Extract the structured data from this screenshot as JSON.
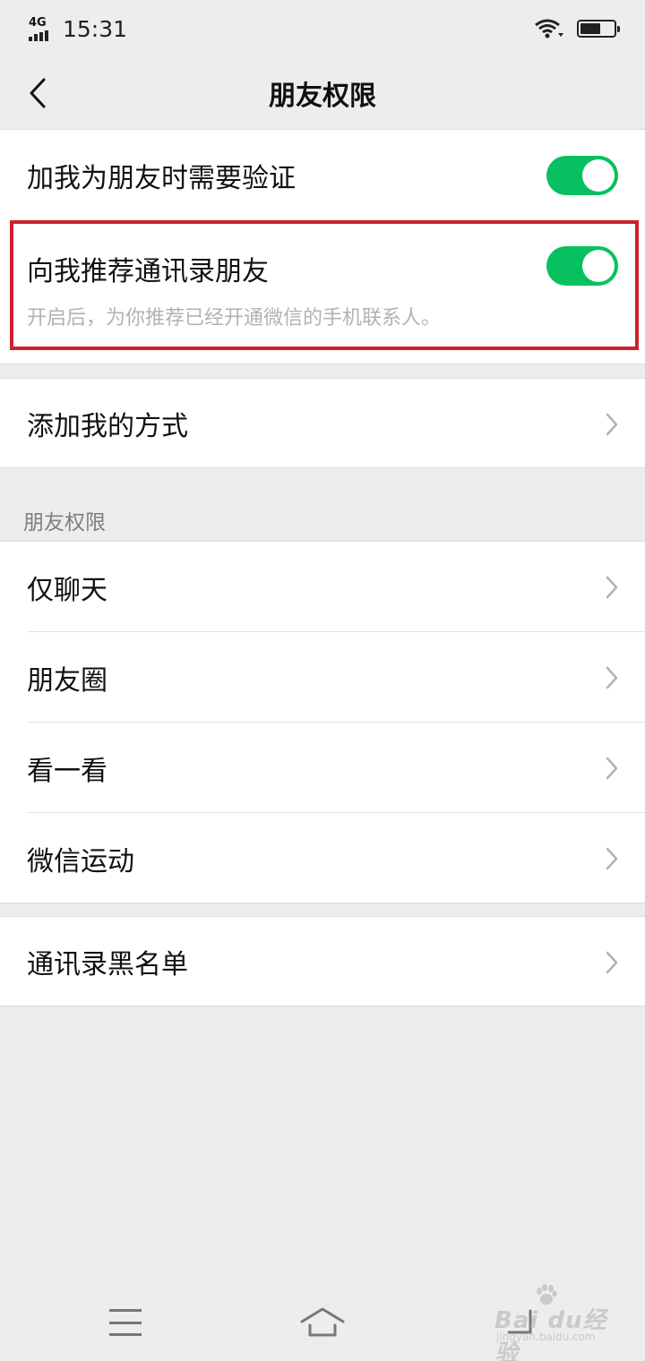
{
  "status_bar": {
    "network": "4G",
    "time": "15:31"
  },
  "header": {
    "title": "朋友权限"
  },
  "settings": {
    "verify_label": "加我为朋友时需要验证",
    "verify_enabled": true,
    "recommend_label": "向我推荐通讯录朋友",
    "recommend_enabled": true,
    "recommend_desc": "开启后，为你推荐已经开通微信的手机联系人。",
    "add_me_label": "添加我的方式"
  },
  "permissions": {
    "section_title": "朋友权限",
    "items": [
      {
        "label": "仅聊天"
      },
      {
        "label": "朋友圈"
      },
      {
        "label": "看一看"
      },
      {
        "label": "微信运动"
      }
    ]
  },
  "blacklist": {
    "label": "通讯录黑名单"
  },
  "watermark": {
    "logo": "Bai  du经验",
    "url": "jingyan.baidu.com"
  },
  "colors": {
    "toggle_on": "#07c160",
    "highlight_border": "#d0202a",
    "page_background": "#ededed"
  }
}
